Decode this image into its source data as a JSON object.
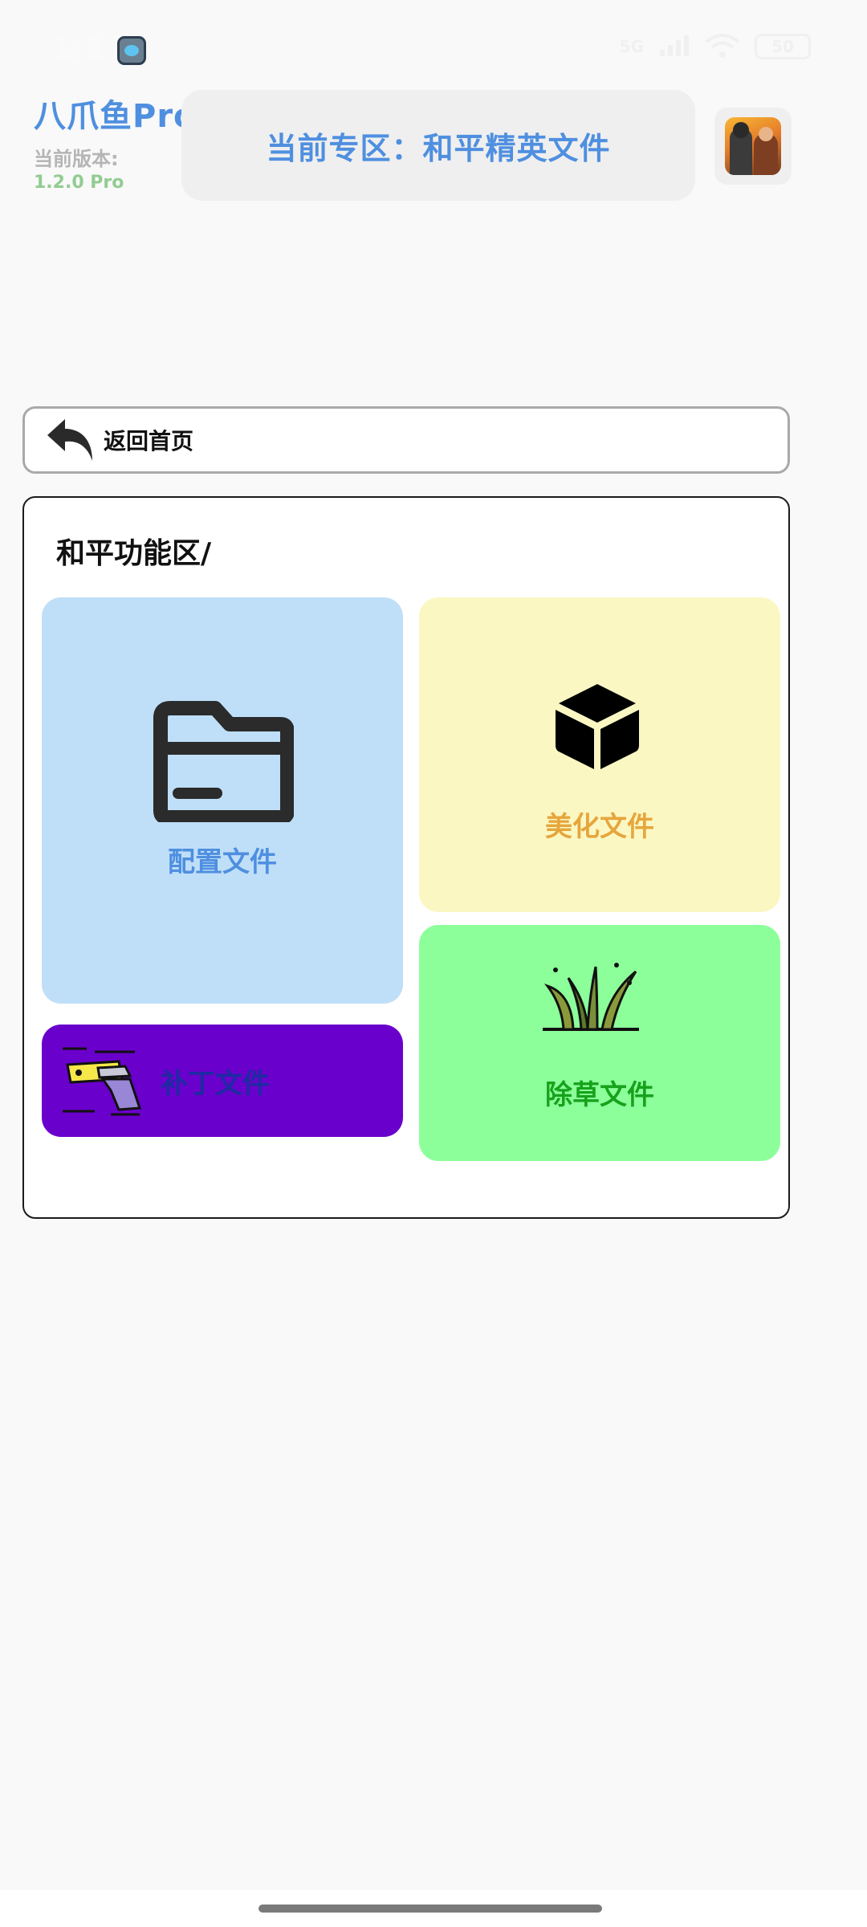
{
  "status_bar": {
    "time": "1:12",
    "network": "5G",
    "battery": "50"
  },
  "header": {
    "app_name": "八爪鱼Pro",
    "version_label": "当前版本:",
    "version_value": "1.2.0 Pro",
    "zone_banner": "当前专区：和平精英文件",
    "game_icon": "game-avatar-icon"
  },
  "back": {
    "label": "返回首页",
    "icon": "back-arrow-icon"
  },
  "panel": {
    "title": "和平功能区/",
    "tiles": [
      {
        "label": "配置文件",
        "icon": "folder-icon",
        "bg": "#bfdff8",
        "color": "#4f8fe0"
      },
      {
        "label": "美化文件",
        "icon": "cube-icon",
        "bg": "#fbf7c3",
        "color": "#e6a63c"
      },
      {
        "label": "补丁文件",
        "icon": "gun-icon",
        "bg": "#6a00cc",
        "color": "#1e2aa3"
      },
      {
        "label": "除草文件",
        "icon": "grass-icon",
        "bg": "#8cff9a",
        "color": "#17a21c"
      }
    ]
  }
}
